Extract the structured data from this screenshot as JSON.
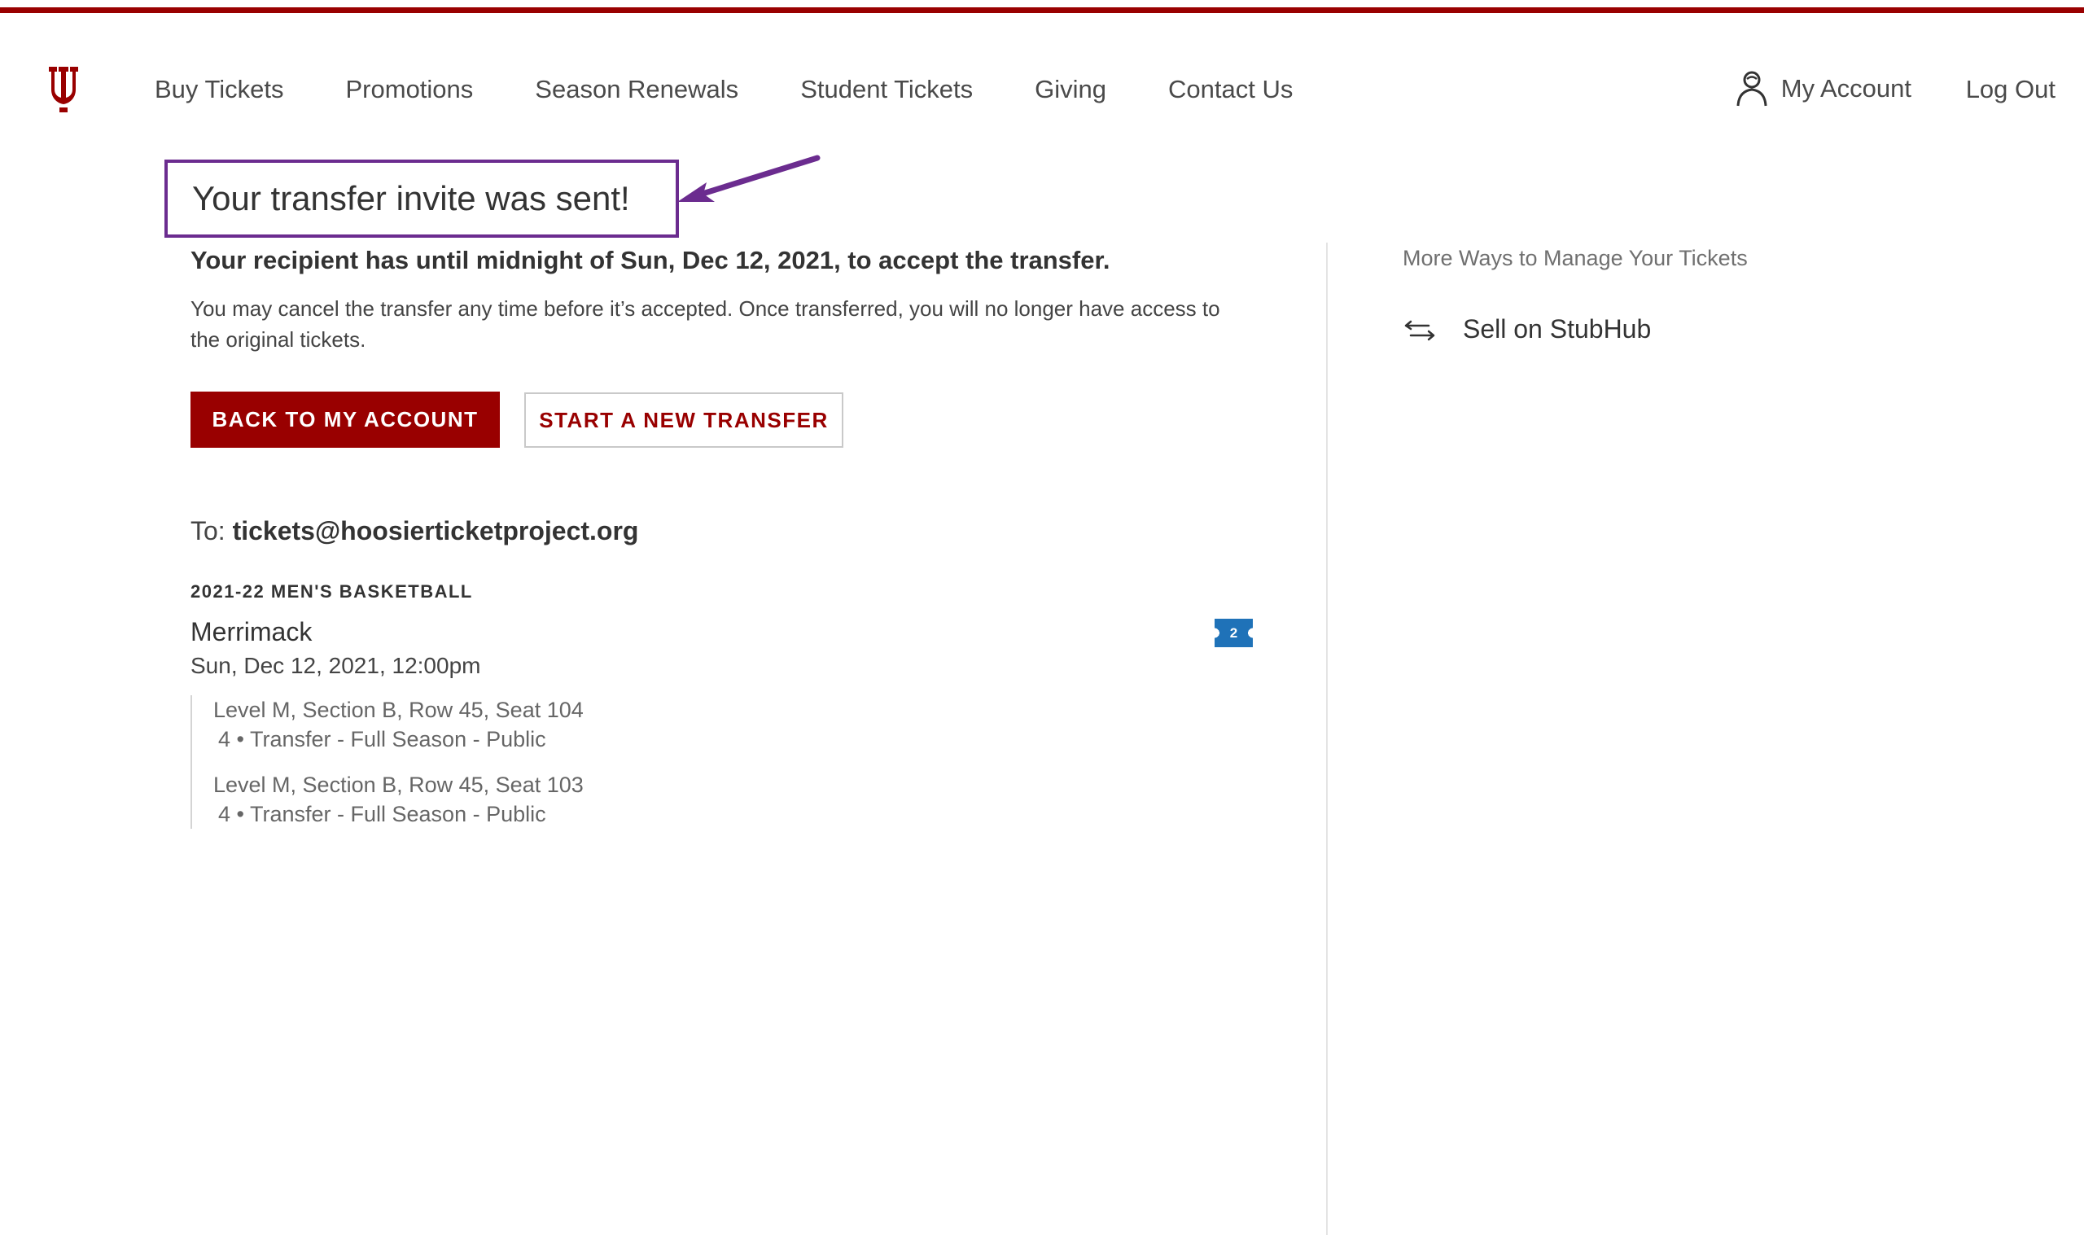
{
  "header": {
    "nav": [
      "Buy Tickets",
      "Promotions",
      "Season Renewals",
      "Student Tickets",
      "Giving",
      "Contact Us"
    ],
    "account_label": "My Account",
    "logout_label": "Log Out"
  },
  "colors": {
    "brand": "#990000",
    "annotation": "#6b2c8f",
    "badge": "#1f72b8"
  },
  "icons": {
    "logo": "iu-trident-logo",
    "account": "user-icon",
    "stubhub": "swap-arrows-icon"
  },
  "confirmation": {
    "headline": "Your transfer invite was sent!",
    "deadline": "Your recipient has until midnight of Sun, Dec 12, 2021, to accept the transfer.",
    "info": "You may cancel the transfer any time before it’s accepted. Once transferred, you will no longer have access to the original tickets.",
    "primary_button": "BACK TO MY ACCOUNT",
    "secondary_button": "START A NEW TRANSFER"
  },
  "transfer": {
    "to_prefix": "To: ",
    "recipient": "tickets@hoosierticketproject.org",
    "event_kicker": "2021-22 MEN'S BASKETBALL",
    "event_name": "Merrimack",
    "event_date": "Sun, Dec 12, 2021, 12:00pm",
    "ticket_count": "2",
    "seats": [
      {
        "location": "Level M, Section B, Row 45, Seat 104",
        "type": "4 • Transfer - Full Season - Public"
      },
      {
        "location": "Level M, Section B, Row 45, Seat 103",
        "type": "4 • Transfer - Full Season - Public"
      }
    ]
  },
  "sidebar": {
    "title": "More Ways to Manage Your Tickets",
    "link_label": "Sell on StubHub"
  }
}
